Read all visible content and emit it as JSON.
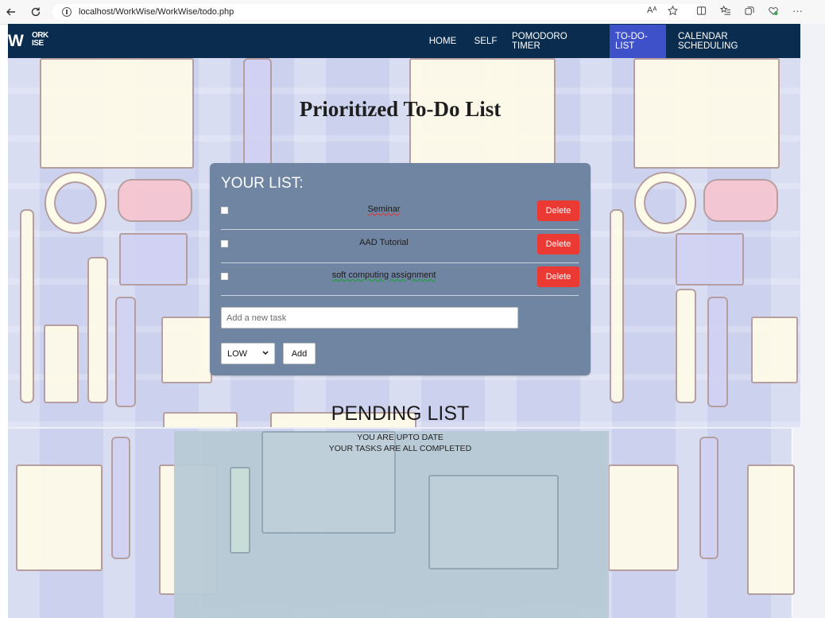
{
  "browser": {
    "url": "localhost/WorkWise/WorkWise/todo.php",
    "icons": [
      "back-icon",
      "reload-icon",
      "info-icon",
      "read-aloud-icon",
      "favorite-icon",
      "split-screen-icon",
      "favorites-icon",
      "collections-icon",
      "extensions-icon",
      "more-icon"
    ],
    "read_aloud": "Aᴬ",
    "more": "···"
  },
  "logo": {
    "big": "W",
    "small_top": "ORK",
    "small_bottom": "ISE"
  },
  "nav": {
    "items": [
      {
        "label": "HOME"
      },
      {
        "label": "SELF"
      },
      {
        "label": "POMODORO TIMER"
      },
      {
        "label": "TO-DO-LIST"
      },
      {
        "label": "CALENDAR SCHEDULING"
      }
    ],
    "active": "TO-DO-LIST",
    "active_color": "#3f51c9",
    "bar_color": "#0a2d4f"
  },
  "page": {
    "title": "Prioritized To-Do List"
  },
  "list": {
    "heading": "YOUR LIST:",
    "tasks": [
      {
        "name": "Seminar",
        "checked": false,
        "delete_label": "Delete",
        "spell_mark": "red"
      },
      {
        "name": "AAD Tutorial",
        "checked": false,
        "delete_label": "Delete",
        "spell_mark": "none"
      },
      {
        "name": "soft computing assignment",
        "checked": false,
        "delete_label": "Delete",
        "spell_mark": "green"
      }
    ],
    "input_placeholder": "Add a new task",
    "input_value": "",
    "priority_selected": "LOW",
    "add_label": "Add",
    "card_color": "#6f85a2",
    "delete_color": "#ea3a33"
  },
  "pending": {
    "heading": "PENDING LIST",
    "line1": "YOU ARE UPTO DATE",
    "line2": "YOUR TASKS ARE ALL COMPLETED"
  }
}
